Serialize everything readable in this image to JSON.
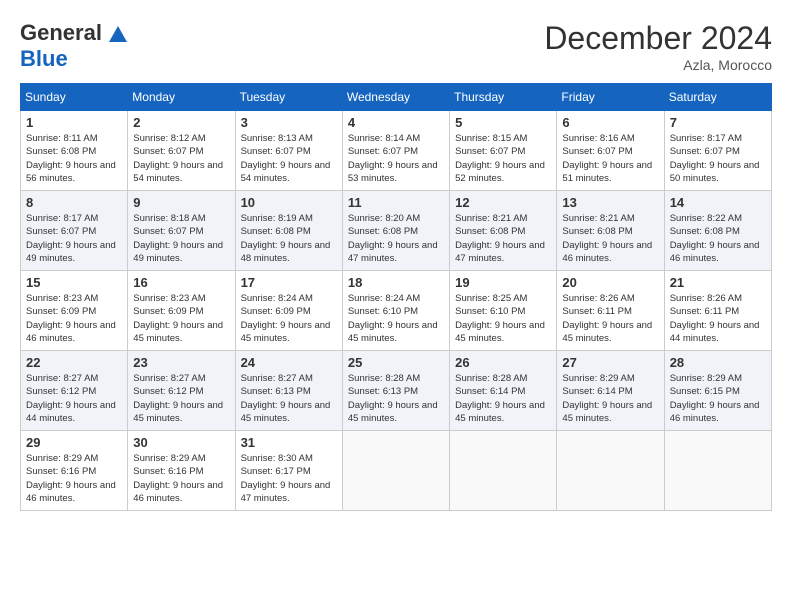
{
  "header": {
    "logo_general": "General",
    "logo_blue": "Blue",
    "month_title": "December 2024",
    "location": "Azla, Morocco"
  },
  "weekdays": [
    "Sunday",
    "Monday",
    "Tuesday",
    "Wednesday",
    "Thursday",
    "Friday",
    "Saturday"
  ],
  "weeks": [
    [
      {
        "day": "1",
        "sunrise": "Sunrise: 8:11 AM",
        "sunset": "Sunset: 6:08 PM",
        "daylight": "Daylight: 9 hours and 56 minutes."
      },
      {
        "day": "2",
        "sunrise": "Sunrise: 8:12 AM",
        "sunset": "Sunset: 6:07 PM",
        "daylight": "Daylight: 9 hours and 54 minutes."
      },
      {
        "day": "3",
        "sunrise": "Sunrise: 8:13 AM",
        "sunset": "Sunset: 6:07 PM",
        "daylight": "Daylight: 9 hours and 54 minutes."
      },
      {
        "day": "4",
        "sunrise": "Sunrise: 8:14 AM",
        "sunset": "Sunset: 6:07 PM",
        "daylight": "Daylight: 9 hours and 53 minutes."
      },
      {
        "day": "5",
        "sunrise": "Sunrise: 8:15 AM",
        "sunset": "Sunset: 6:07 PM",
        "daylight": "Daylight: 9 hours and 52 minutes."
      },
      {
        "day": "6",
        "sunrise": "Sunrise: 8:16 AM",
        "sunset": "Sunset: 6:07 PM",
        "daylight": "Daylight: 9 hours and 51 minutes."
      },
      {
        "day": "7",
        "sunrise": "Sunrise: 8:17 AM",
        "sunset": "Sunset: 6:07 PM",
        "daylight": "Daylight: 9 hours and 50 minutes."
      }
    ],
    [
      {
        "day": "8",
        "sunrise": "Sunrise: 8:17 AM",
        "sunset": "Sunset: 6:07 PM",
        "daylight": "Daylight: 9 hours and 49 minutes."
      },
      {
        "day": "9",
        "sunrise": "Sunrise: 8:18 AM",
        "sunset": "Sunset: 6:07 PM",
        "daylight": "Daylight: 9 hours and 49 minutes."
      },
      {
        "day": "10",
        "sunrise": "Sunrise: 8:19 AM",
        "sunset": "Sunset: 6:08 PM",
        "daylight": "Daylight: 9 hours and 48 minutes."
      },
      {
        "day": "11",
        "sunrise": "Sunrise: 8:20 AM",
        "sunset": "Sunset: 6:08 PM",
        "daylight": "Daylight: 9 hours and 47 minutes."
      },
      {
        "day": "12",
        "sunrise": "Sunrise: 8:21 AM",
        "sunset": "Sunset: 6:08 PM",
        "daylight": "Daylight: 9 hours and 47 minutes."
      },
      {
        "day": "13",
        "sunrise": "Sunrise: 8:21 AM",
        "sunset": "Sunset: 6:08 PM",
        "daylight": "Daylight: 9 hours and 46 minutes."
      },
      {
        "day": "14",
        "sunrise": "Sunrise: 8:22 AM",
        "sunset": "Sunset: 6:08 PM",
        "daylight": "Daylight: 9 hours and 46 minutes."
      }
    ],
    [
      {
        "day": "15",
        "sunrise": "Sunrise: 8:23 AM",
        "sunset": "Sunset: 6:09 PM",
        "daylight": "Daylight: 9 hours and 46 minutes."
      },
      {
        "day": "16",
        "sunrise": "Sunrise: 8:23 AM",
        "sunset": "Sunset: 6:09 PM",
        "daylight": "Daylight: 9 hours and 45 minutes."
      },
      {
        "day": "17",
        "sunrise": "Sunrise: 8:24 AM",
        "sunset": "Sunset: 6:09 PM",
        "daylight": "Daylight: 9 hours and 45 minutes."
      },
      {
        "day": "18",
        "sunrise": "Sunrise: 8:24 AM",
        "sunset": "Sunset: 6:10 PM",
        "daylight": "Daylight: 9 hours and 45 minutes."
      },
      {
        "day": "19",
        "sunrise": "Sunrise: 8:25 AM",
        "sunset": "Sunset: 6:10 PM",
        "daylight": "Daylight: 9 hours and 45 minutes."
      },
      {
        "day": "20",
        "sunrise": "Sunrise: 8:26 AM",
        "sunset": "Sunset: 6:11 PM",
        "daylight": "Daylight: 9 hours and 45 minutes."
      },
      {
        "day": "21",
        "sunrise": "Sunrise: 8:26 AM",
        "sunset": "Sunset: 6:11 PM",
        "daylight": "Daylight: 9 hours and 44 minutes."
      }
    ],
    [
      {
        "day": "22",
        "sunrise": "Sunrise: 8:27 AM",
        "sunset": "Sunset: 6:12 PM",
        "daylight": "Daylight: 9 hours and 44 minutes."
      },
      {
        "day": "23",
        "sunrise": "Sunrise: 8:27 AM",
        "sunset": "Sunset: 6:12 PM",
        "daylight": "Daylight: 9 hours and 45 minutes."
      },
      {
        "day": "24",
        "sunrise": "Sunrise: 8:27 AM",
        "sunset": "Sunset: 6:13 PM",
        "daylight": "Daylight: 9 hours and 45 minutes."
      },
      {
        "day": "25",
        "sunrise": "Sunrise: 8:28 AM",
        "sunset": "Sunset: 6:13 PM",
        "daylight": "Daylight: 9 hours and 45 minutes."
      },
      {
        "day": "26",
        "sunrise": "Sunrise: 8:28 AM",
        "sunset": "Sunset: 6:14 PM",
        "daylight": "Daylight: 9 hours and 45 minutes."
      },
      {
        "day": "27",
        "sunrise": "Sunrise: 8:29 AM",
        "sunset": "Sunset: 6:14 PM",
        "daylight": "Daylight: 9 hours and 45 minutes."
      },
      {
        "day": "28",
        "sunrise": "Sunrise: 8:29 AM",
        "sunset": "Sunset: 6:15 PM",
        "daylight": "Daylight: 9 hours and 46 minutes."
      }
    ],
    [
      {
        "day": "29",
        "sunrise": "Sunrise: 8:29 AM",
        "sunset": "Sunset: 6:16 PM",
        "daylight": "Daylight: 9 hours and 46 minutes."
      },
      {
        "day": "30",
        "sunrise": "Sunrise: 8:29 AM",
        "sunset": "Sunset: 6:16 PM",
        "daylight": "Daylight: 9 hours and 46 minutes."
      },
      {
        "day": "31",
        "sunrise": "Sunrise: 8:30 AM",
        "sunset": "Sunset: 6:17 PM",
        "daylight": "Daylight: 9 hours and 47 minutes."
      },
      null,
      null,
      null,
      null
    ]
  ]
}
